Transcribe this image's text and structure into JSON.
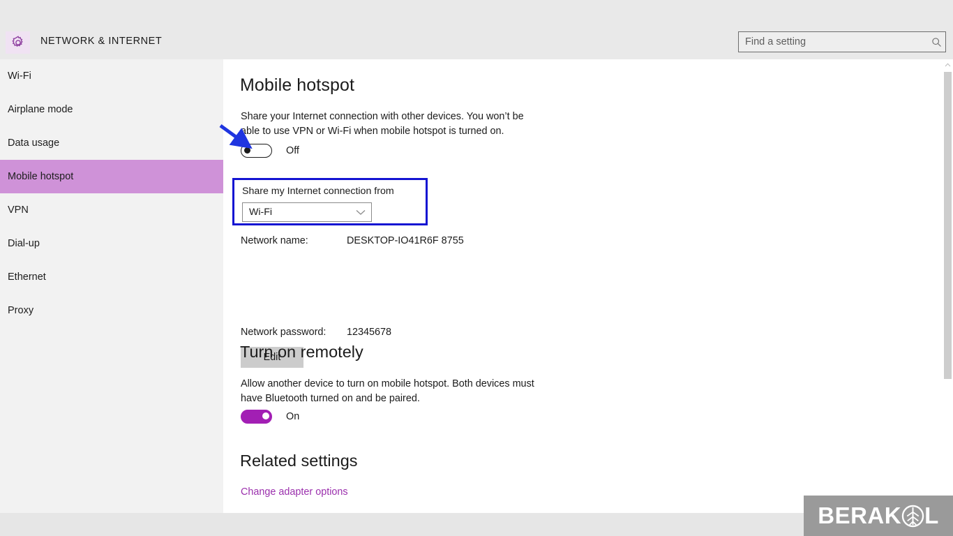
{
  "header": {
    "title": "NETWORK & INTERNET",
    "gear_icon": "gear-icon",
    "search": {
      "placeholder": "Find a setting",
      "value": "",
      "icon": "search-icon"
    }
  },
  "sidebar": {
    "items": [
      {
        "label": "Wi-Fi",
        "selected": false
      },
      {
        "label": "Airplane mode",
        "selected": false
      },
      {
        "label": "Data usage",
        "selected": false
      },
      {
        "label": "Mobile hotspot",
        "selected": true
      },
      {
        "label": "VPN",
        "selected": false
      },
      {
        "label": "Dial-up",
        "selected": false
      },
      {
        "label": "Ethernet",
        "selected": false
      },
      {
        "label": "Proxy",
        "selected": false
      }
    ],
    "selected_color": "#cf92d8"
  },
  "main": {
    "hotspot": {
      "heading": "Mobile hotspot",
      "description": "Share your Internet connection with other devices. You won’t be able to use VPN or Wi-Fi when mobile hotspot is turned on.",
      "toggle_state": "Off",
      "share_label": "Share my Internet connection from",
      "share_value": "Wi-Fi",
      "dropdown_icon": "chevron-down-icon",
      "network_name_label": "Network name:",
      "network_name_value": "DESKTOP-IO41R6F 8755",
      "network_password_label": "Network password:",
      "network_password_value": "12345678",
      "edit_label": "Edit"
    },
    "remote": {
      "heading": "Turn on remotely",
      "description": "Allow another device to turn on mobile hotspot. Both devices must have Bluetooth turned on and be paired.",
      "toggle_state": "On"
    },
    "related": {
      "heading": "Related settings",
      "link_label": "Change adapter options"
    }
  },
  "annotations": {
    "arrow_color": "#1414d2",
    "highlight_box_color": "#1414d2"
  },
  "scrollbar": {
    "up_icon": "chevron-up-icon",
    "down_icon": "chevron-down-icon"
  },
  "watermark": {
    "text_before": "BERAK",
    "text_after": "L",
    "glyph": "leaf-brain-icon"
  },
  "colors": {
    "accent_purple": "#a21fb4",
    "link_purple": "#9b30ad",
    "header_bg": "#e9e9e9",
    "sidebar_bg": "#f2f2f2",
    "content_bg": "#ffffff"
  }
}
